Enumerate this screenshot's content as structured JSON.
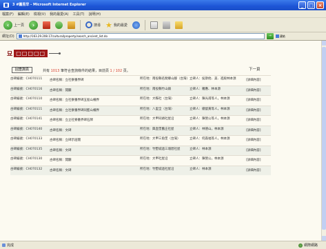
{
  "window": {
    "title": "3 #圖昆早 - Microsoft Internet Explorer",
    "min_glyph": "_",
    "max_glyph": "□",
    "close_glyph": "×"
  },
  "menu": {
    "items": [
      "檔案(F)",
      "編輯(E)",
      "檢視(V)",
      "我的最愛(A)",
      "工具(T)",
      "說明(H)"
    ]
  },
  "toolbar": {
    "back_label": "上一頁",
    "search_label": "搜尋",
    "favorites_label": "我的最愛"
  },
  "address": {
    "label": "網址(D)",
    "url": "http://163.29.208.17/cultural/property/search_ancient_list.do",
    "go_label": "→",
    "links_label": "連結"
  },
  "status": {
    "text": "完成",
    "zone": "網際網路"
  },
  "page": {
    "banner_prefix": "묘",
    "banner_title": "□□□□□",
    "back_button": "回查詢頁",
    "results_prefix": "共有",
    "results_count": "1013",
    "results_mid": "筆符合查詢條件的結果，目前頁",
    "results_page": "1 / 102",
    "results_suffix": "頁。",
    "next_page": "下一頁",
    "detail_link": "[詳細內容]"
  },
  "rows": [
    {
      "id": "古碑編號：CH070111",
      "name": "古碑名稱：立社寮番界碑",
      "loc": "所在地：南投縣名間鄉山腳（台灣）",
      "reg": "立碑人：侯斯他．美．進殿林本源"
    },
    {
      "id": "古碑編號：CH070116",
      "name": "古碑名稱：開闢",
      "loc": "所在地：南投縣竹山鎮",
      "reg": "立碑人：羅應、林本源"
    },
    {
      "id": "古碑編號：CH070110",
      "name": "古碑名稱：立社寮番界碑五股山柵界",
      "loc": "所在地：大鞍社（台灣）",
      "reg": "立碑人：陳光甫等人，林本源"
    },
    {
      "id": "古碑編號：CH070111",
      "name": "古碑名稱：立社寮番界碑同籃山柵界",
      "loc": "所在地：八里全（台灣）",
      "reg": "立碑人：總督黃等人，林本源"
    },
    {
      "id": "古碑編號：CH070141",
      "name": "古碑名稱：立立社寮番界碑石牌",
      "loc": "所在地：大甲同頭社屋沿",
      "reg": "立碑人：陳營公等人，林本源"
    },
    {
      "id": "古碑編號：CH070140",
      "name": "古碑名稱：文碑",
      "loc": "所在地：興直堡舊庄社屋",
      "reg": "立碑人：林德山，林本源"
    },
    {
      "id": "古碑編號：CH070133",
      "name": "古碑名稱：立碑示詔閱",
      "loc": "所在地：大甲三角堡（台灣）",
      "reg": "立碑人：何森福等人，林本源"
    },
    {
      "id": "古碑編號：CH070135",
      "name": "古碑名稱：文碑",
      "loc": "所在地：竹塹城過三塊厝社屋",
      "reg": "立碑人：林本源"
    },
    {
      "id": "古碑編號：CH070130",
      "name": "古碑名稱：開闢",
      "loc": "所在地：大甲社屋沿",
      "reg": "立碑人：陳營公，林本源"
    },
    {
      "id": "古碑編號：CH070132",
      "name": "古碑名稱：文碑",
      "loc": "所在地：竹塹城過社屋沿",
      "reg": "立碑人：林本源"
    }
  ]
}
